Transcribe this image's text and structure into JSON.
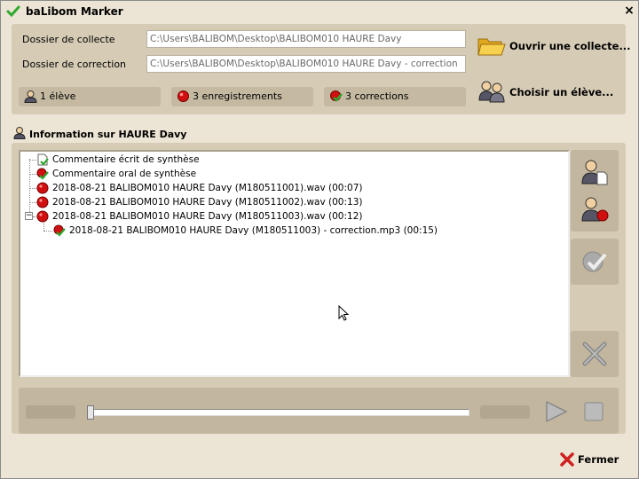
{
  "window": {
    "title": "baLibom Marker",
    "close_glyph": "×"
  },
  "collect": {
    "label_collecte": "Dossier de collecte",
    "path_collecte": "C:\\Users\\BALIBOM\\Desktop\\BALIBOM010 HAURE Davy",
    "label_correction": "Dossier de correction",
    "path_correction": "C:\\Users\\BALIBOM\\Desktop\\BALIBOM010 HAURE Davy - correction",
    "open_button": "Ouvrir une collecte...",
    "choose_button": "Choisir un élève..."
  },
  "stats": {
    "students": "1 élève",
    "recordings": "3 enregistrements",
    "corrections": "3 corrections"
  },
  "info": {
    "title": "Information sur HAURE Davy",
    "items": [
      {
        "label": "Commentaire écrit de synthèse",
        "icon": "written-comment-icon"
      },
      {
        "label": "Commentaire oral de synthèse",
        "icon": "oral-comment-icon"
      },
      {
        "label": "2018-08-21 BALIBOM010 HAURE Davy (M180511001).wav (00:07)",
        "icon": "recording-icon"
      },
      {
        "label": "2018-08-21 BALIBOM010 HAURE Davy (M180511002).wav (00:13)",
        "icon": "recording-icon"
      },
      {
        "label": "2018-08-21 BALIBOM010 HAURE Davy (M180511003).wav (00:12)",
        "icon": "recording-icon"
      },
      {
        "label": "2018-08-21 BALIBOM010 HAURE Davy (M180511003) - correction.mp3 (00:15)",
        "icon": "correction-icon"
      }
    ]
  },
  "footer": {
    "close_label": "Fermer"
  },
  "colors": {
    "panel": "#d6cbb5",
    "window": "#ece4d4",
    "record_red": "#d01010",
    "check_green": "#2ea82e"
  }
}
